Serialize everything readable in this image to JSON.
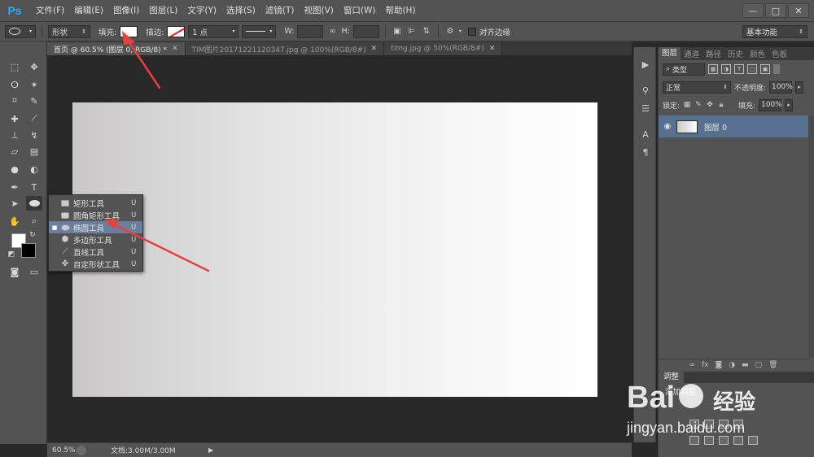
{
  "app": {
    "logo": "Ps",
    "menu": [
      "文件(F)",
      "编辑(E)",
      "图像(I)",
      "图层(L)",
      "文字(Y)",
      "选择(S)",
      "滤镜(T)",
      "视图(V)",
      "窗口(W)",
      "帮助(H)"
    ],
    "window_controls": [
      "—",
      "□",
      "✕"
    ]
  },
  "options_bar": {
    "mode": "形状",
    "fill_label": "填充:",
    "stroke_label": "描边:",
    "stroke_size": "1 点",
    "width_label": "W:",
    "height_label": "H:",
    "align_edges_label": "对齐边缘",
    "workspace": "基本功能"
  },
  "tabs": [
    {
      "label": "首页 @ 60.5% (图层 0, RGB/8) *",
      "active": true
    },
    {
      "label": "TIM图片20171221120347.jpg @ 100%(RGB/8#)",
      "active": false
    },
    {
      "label": "timg.jpg @ 50%(RGB/8#)",
      "active": false
    }
  ],
  "flyout": [
    {
      "label": "矩形工具",
      "key": "U",
      "icon": "rectangle-icon",
      "selected": false
    },
    {
      "label": "圆角矩形工具",
      "key": "U",
      "icon": "rounded-rectangle-icon",
      "selected": false
    },
    {
      "label": "椭圆工具",
      "key": "U",
      "icon": "ellipse-icon",
      "selected": true
    },
    {
      "label": "多边形工具",
      "key": "U",
      "icon": "polygon-icon",
      "selected": false
    },
    {
      "label": "直线工具",
      "key": "U",
      "icon": "line-icon",
      "selected": false
    },
    {
      "label": "自定形状工具",
      "key": "U",
      "icon": "custom-shape-icon",
      "selected": false
    }
  ],
  "status": {
    "zoom": "60.5%",
    "doc_info": "文档:3.00M/3.00M"
  },
  "layers_panel": {
    "tabs": [
      "图层",
      "通道",
      "路径",
      "历史",
      "颜色",
      "色板"
    ],
    "kind": "类型",
    "blend_mode": "正常",
    "opacity_label": "不透明度:",
    "opacity": "100%",
    "lock_label": "锁定:",
    "fill_label": "填充:",
    "fill": "100%",
    "layer_name": "图层 0"
  },
  "adjust_panel": {
    "title": "调整",
    "subtitle": "添加调整"
  },
  "watermark": {
    "brand": "Bai",
    "brand_cn": "经验",
    "url": "jingyan.baidu.com"
  },
  "colors": {
    "accent": "#31a8ff",
    "selection": "#6a7f9e",
    "layer_selected": "#58708f",
    "annotation_arrow": "#e8403c"
  }
}
